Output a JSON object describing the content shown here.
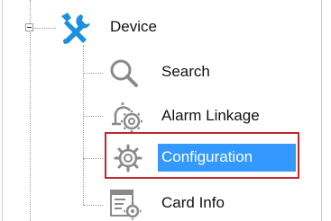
{
  "tree": {
    "root": {
      "label": "Device",
      "icon": "device-tools-icon",
      "expanded": true
    },
    "children": [
      {
        "label": "Search",
        "icon": "magnifier-icon",
        "selected": false
      },
      {
        "label": "Alarm Linkage",
        "icon": "alarm-bell-gear-icon",
        "selected": false
      },
      {
        "label": "Configuration",
        "icon": "gear-icon",
        "selected": true
      },
      {
        "label": "Card Info",
        "icon": "card-info-form-icon",
        "selected": false
      }
    ],
    "colors": {
      "selection": "#3399ff",
      "highlight_border": "#c0272d",
      "device_icon": "#1e8fe0"
    }
  }
}
